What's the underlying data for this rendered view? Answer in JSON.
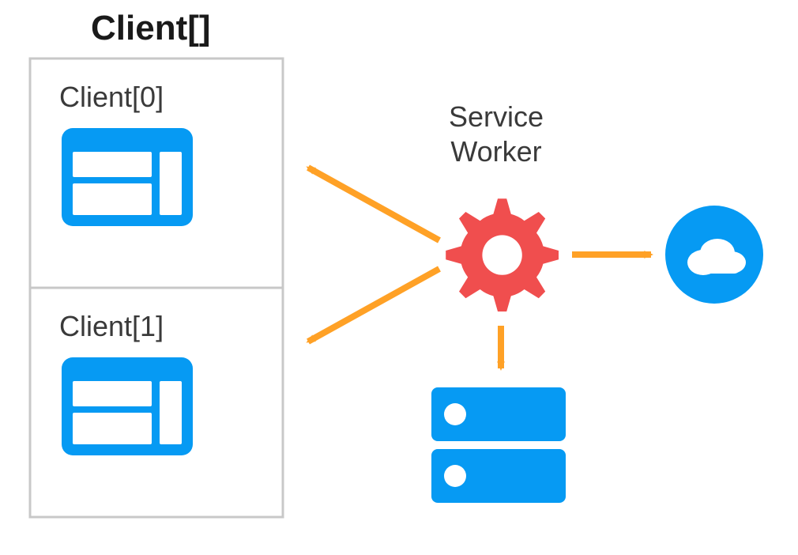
{
  "diagram": {
    "title": "Client[]",
    "clients": [
      {
        "label": "Client[0]"
      },
      {
        "label": "Client[1]"
      }
    ],
    "service_worker": {
      "label_line1": "Service",
      "label_line2": "Worker"
    },
    "colors": {
      "blue": "#069AF3",
      "red": "#F04E4E",
      "orange": "#FFA126",
      "grey_border": "#C8C8C8",
      "text": "#3A3A3A"
    },
    "nodes": {
      "clients": "browser-window",
      "service_worker": "gear",
      "storage": "database-server",
      "network": "cloud"
    },
    "arrows": [
      {
        "from": "service_worker",
        "to": "client0",
        "bidirectional": false
      },
      {
        "from": "service_worker",
        "to": "client1",
        "bidirectional": false
      },
      {
        "from": "service_worker",
        "to": "storage",
        "bidirectional": false
      },
      {
        "from": "service_worker",
        "to": "network",
        "bidirectional": false
      }
    ]
  }
}
